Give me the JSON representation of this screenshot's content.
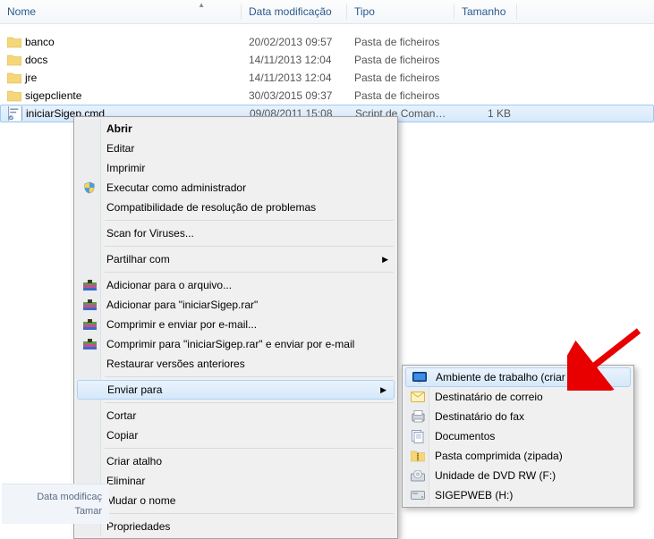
{
  "columns": {
    "name": "Nome",
    "date": "Data modificação",
    "type": "Tipo",
    "size": "Tamanho"
  },
  "files": [
    {
      "name": "banco",
      "date": "20/02/2013 09:57",
      "type": "Pasta de ficheiros",
      "size": "",
      "kind": "folder"
    },
    {
      "name": "docs",
      "date": "14/11/2013 12:04",
      "type": "Pasta de ficheiros",
      "size": "",
      "kind": "folder"
    },
    {
      "name": "jre",
      "date": "14/11/2013 12:04",
      "type": "Pasta de ficheiros",
      "size": "",
      "kind": "folder"
    },
    {
      "name": "sigepcliente",
      "date": "30/03/2015 09:37",
      "type": "Pasta de ficheiros",
      "size": "",
      "kind": "folder"
    },
    {
      "name": "iniciarSigep.cmd",
      "date": "09/08/2011 15:08",
      "type": "Script de Comand...",
      "size": "1 KB",
      "kind": "cmd",
      "selected": true
    }
  ],
  "menu": {
    "abrir": "Abrir",
    "editar": "Editar",
    "imprimir": "Imprimir",
    "exec_admin": "Executar como administrador",
    "compat": "Compatibilidade de resolução de problemas",
    "scan": "Scan for Viruses...",
    "partilhar": "Partilhar com",
    "add_arq": "Adicionar para o arquivo...",
    "add_rar": "Adicionar para \"iniciarSigep.rar\"",
    "compr_mail": "Comprimir e enviar por e-mail...",
    "compr_rar_mail": "Comprimir para \"iniciarSigep.rar\" e enviar por e-mail",
    "restaurar": "Restaurar versões anteriores",
    "enviar": "Enviar para",
    "cortar": "Cortar",
    "copiar": "Copiar",
    "criar_atalho": "Criar atalho",
    "eliminar": "Eliminar",
    "mudar": "Mudar o nome",
    "propriedades": "Propriedades"
  },
  "submenu": {
    "desktop": "Ambiente de trabalho (criar atalho)",
    "mail": "Destinatário de correio",
    "fax": "Destinatário do fax",
    "docs": "Documentos",
    "zip": "Pasta comprimida (zipada)",
    "dvd": "Unidade de DVD RW (F:)",
    "sigep": "SIGEPWEB (H:)"
  },
  "status": {
    "line1": "Data modificaç",
    "line2": "Tamar"
  }
}
